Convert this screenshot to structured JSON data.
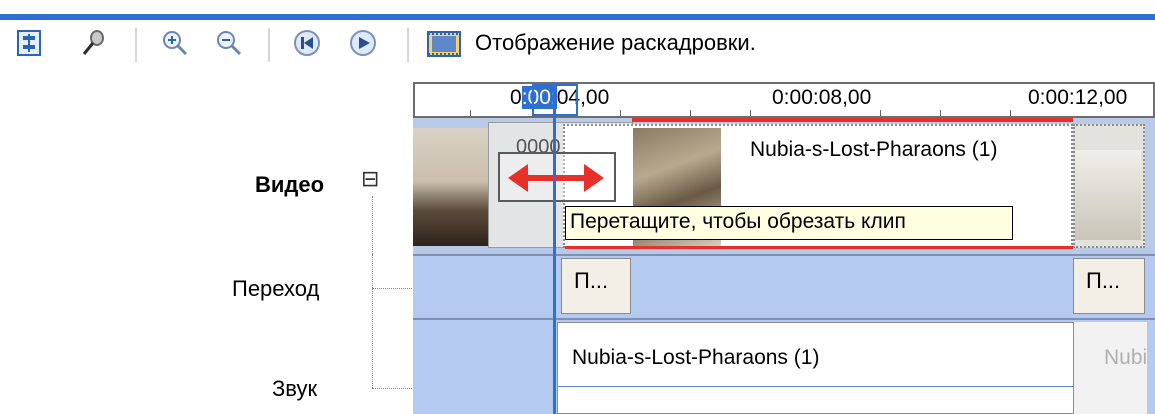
{
  "toolbar": {
    "buttons": [
      {
        "name": "set-audio-levels",
        "icon": "audio-levels-icon"
      },
      {
        "name": "narrate-timeline",
        "icon": "microphone-icon"
      },
      {
        "name": "zoom-in",
        "icon": "zoom-in-icon"
      },
      {
        "name": "zoom-out",
        "icon": "zoom-out-icon"
      },
      {
        "name": "rewind",
        "icon": "rewind-icon"
      },
      {
        "name": "play",
        "icon": "play-icon"
      }
    ],
    "storyboard_label": "Отображение раскадровки."
  },
  "tracks": {
    "video_label": "Видео",
    "video_toggle": "⊟",
    "transition_label": "Переход",
    "audio_label": "Звук"
  },
  "ruler": {
    "t1": "0:00:04,00",
    "t1_left": "0",
    "t1_highlight": ":00:",
    "t1_right": "04,00",
    "t2": "0:00:08,00",
    "t3_left": "0:00",
    "t3_right": ":12,00"
  },
  "video": {
    "clip_title": "Nubia-s-Lost-Pharaons (1)",
    "drag_overlay_text": "0000"
  },
  "transition": {
    "box1": "П...",
    "box2": "П..."
  },
  "audio": {
    "clip_title": "Nubia-s-Lost-Pharaons (1)",
    "next_clip_title": "Nubia"
  },
  "tooltip": "Перетащите, чтобы обрезать клип",
  "colors": {
    "accent": "#2f6fd1",
    "track_bg": "#b5caf0",
    "trim_arrow": "#e8302a"
  }
}
